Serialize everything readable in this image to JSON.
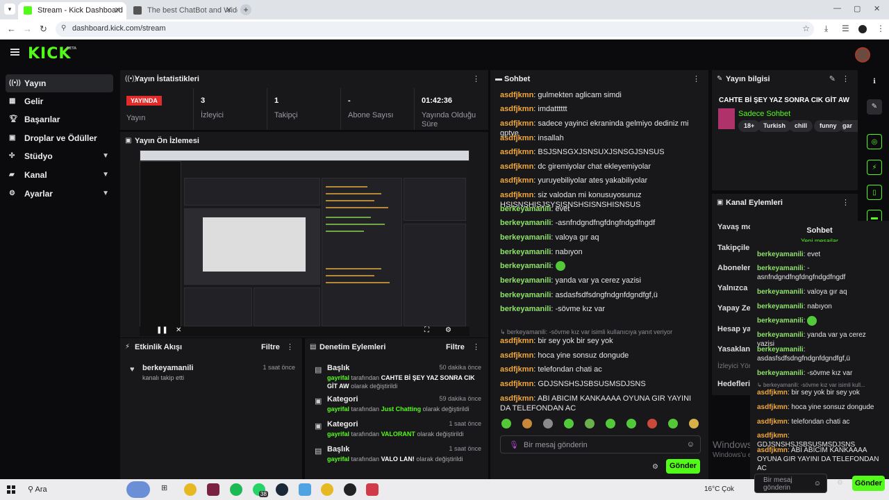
{
  "browser": {
    "tabs": [
      {
        "label": "Stream - Kick Dashboard"
      },
      {
        "label": "The best ChatBot and Widgets"
      }
    ],
    "new_tab": "+",
    "url": "dashboard.kick.com/stream",
    "window_controls": {
      "minimize": "—",
      "restore": "▢",
      "close": "✕"
    }
  },
  "header": {
    "logo": "KICK",
    "beta": "BETA"
  },
  "sidebar": {
    "items": [
      {
        "label": "Yayın",
        "icon": "broadcast-icon"
      },
      {
        "label": "Gelir",
        "icon": "revenue-icon"
      },
      {
        "label": "Başarılar",
        "icon": "trophy-icon"
      },
      {
        "label": "Droplar ve Ödüller",
        "icon": "gift-icon"
      },
      {
        "label": "Stüdyo",
        "icon": "studio-icon"
      },
      {
        "label": "Kanal",
        "icon": "channel-icon"
      },
      {
        "label": "Ayarlar",
        "icon": "settings-icon"
      }
    ]
  },
  "stats": {
    "title": "Yayın İstatistikleri",
    "live_badge": "YAYINDA",
    "live_label": "Yayın",
    "items": [
      {
        "value": "3",
        "label": "İzleyici"
      },
      {
        "value": "1",
        "label": "Takipçi"
      },
      {
        "value": "-",
        "label": "Abone Sayısı"
      },
      {
        "value": "01:42:36",
        "label": "Yayında Olduğu Süre"
      }
    ]
  },
  "preview": {
    "title": "Yayın Ön İzlemesi"
  },
  "activity": {
    "title": "Etkinlik Akışı",
    "filter": "Filtre",
    "items": [
      {
        "user": "berkeyamanili",
        "text": "kanalı takip etti",
        "time": "1 saat önce"
      }
    ]
  },
  "moderation": {
    "title": "Denetim Eylemleri",
    "filter": "Filtre",
    "items": [
      {
        "kind": "Başlık",
        "user": "gayrifal",
        "mid": "tarafından",
        "value": "CAHTE Bİ ŞEY YAZ SONRA CIK GİT AW",
        "tail": "olarak değiştirildi",
        "time": "50 dakika önce"
      },
      {
        "kind": "Kategori",
        "user": "gayrifal",
        "mid": "tarafından",
        "value": "Just Chatting",
        "tail": "olarak değiştirildi",
        "time": "59 dakika önce"
      },
      {
        "kind": "Kategori",
        "user": "gayrifal",
        "mid": "tarafından",
        "value": "VALORANT",
        "tail": "olarak değiştirildi",
        "time": "1 saat önce"
      },
      {
        "kind": "Başlık",
        "user": "gayrifal",
        "mid": "tarafından",
        "value": "VALO LAN!",
        "tail": "olarak değiştirildi",
        "time": "1 saat önce"
      }
    ]
  },
  "chat": {
    "title": "Sohbet",
    "messages": [
      {
        "user": "asdfjkmn",
        "text": "gulmekten aglicam simdi"
      },
      {
        "user": "asdfjkmn",
        "text": "imdatttttt"
      },
      {
        "user": "asdfjkmn",
        "text": "sadece yayinci ekraninda gelmiyo dediniz mi gptye"
      },
      {
        "user": "asdfjkmn",
        "text": "insallah"
      },
      {
        "user": "asdfjkmn",
        "text": "BSJSNSGXJSNSUXJSNSGJSNSUS"
      },
      {
        "user": "asdfjkmn",
        "text": "dc giremiyolar chat ekleyemiyolar"
      },
      {
        "user": "asdfjkmn",
        "text": "yuruyebiliyolar ates yakabiliyolar"
      },
      {
        "user": "asdfjkmn",
        "text": "siz valodan mi konusuyosunuz HSISNSHISJSYSISNSHSISNSHISNSUS"
      },
      {
        "user": "berkeyamanili",
        "text": "evet"
      },
      {
        "user": "berkeyamanili",
        "text": "-asnfndgndfngfdngfndgdfngdf"
      },
      {
        "user": "berkeyamanili",
        "text": "valoya gır aq"
      },
      {
        "user": "berkeyamanili",
        "text": "nabıyon"
      },
      {
        "user": "berkeyamanili",
        "text": ""
      },
      {
        "user": "berkeyamanili",
        "text": "yanda var ya cerez yazisi"
      },
      {
        "user": "berkeyamanili",
        "text": "asdasfsdfsdngfndgnfdgndfgf,ü"
      },
      {
        "user": "berkeyamanili",
        "text": "-sövme kız var"
      },
      {
        "user": "asdfjkmn",
        "text": "bir sey yok bir sey yok"
      },
      {
        "user": "asdfjkmn",
        "text": "hoca yine sonsuz dongude"
      },
      {
        "user": "asdfjkmn",
        "text": "telefondan chati ac"
      },
      {
        "user": "asdfjkmn",
        "text": "GDJSNSHSJSBSUSMSDJSNS"
      },
      {
        "user": "asdfjkmn",
        "text": "ABI ABICIM KANKAAAA OYUNA GIR YAYINI DA TELEFONDAN AC"
      }
    ],
    "reply_hint": "berkeyamanili: -sövme kız var isimli kullanıcıya yanıt veriyor",
    "input_placeholder": "Bir mesaj gönderin",
    "send": "Gönder"
  },
  "stream_info": {
    "title": "Yayın bilgisi",
    "stream_title": "CAHTE Bİ ŞEY YAZ SONRA CIK GİT AW",
    "category": "Sadece Sohbet",
    "tags": [
      "18+",
      "Turkish",
      "chill",
      "funny",
      "gar"
    ]
  },
  "channel_actions": {
    "title": "Kanal Eylemleri",
    "labels": [
      "Yavaş mod",
      "Takipçilere",
      "Abonelere",
      "Yalnızca ifa",
      "Yapay Zek",
      "Hesap yaşı",
      "Yasaklanm",
      "İzleyici Yön",
      "Hedefleri b"
    ]
  },
  "popout": {
    "title": "Sohbet",
    "new_messages": "Yeni mesajlar",
    "messages": [
      {
        "user": "berkeyamanili",
        "text": "evet"
      },
      {
        "user": "berkeyamanili",
        "text": "-asnfndgndfngfdngfndgdfngdf"
      },
      {
        "user": "berkeyamanili",
        "text": "valoya gır aq"
      },
      {
        "user": "berkeyamanili",
        "text": "nabıyon"
      },
      {
        "user": "berkeyamanili",
        "text": ""
      },
      {
        "user": "berkeyamanili",
        "text": "yanda var ya cerez yazisi"
      },
      {
        "user": "berkeyamanili",
        "text": "asdasfsdfsdngfndgnfdgndfgf,ü"
      },
      {
        "user": "berkeyamanili",
        "text": "-sövme kız var"
      },
      {
        "user": "asdfjkmn",
        "text": "bir sey yok bir sey yok"
      },
      {
        "user": "asdfjkmn",
        "text": "hoca yine sonsuz dongude"
      },
      {
        "user": "asdfjkmn",
        "text": "telefondan chati ac"
      },
      {
        "user": "asdfjkmn",
        "text": "GDJSNSHSJSBSUSMSDJSNS"
      },
      {
        "user": "asdfjkmn",
        "text": "ABI ABICIM KANKAAAA OYUNA GIR YAYINI DA TELEFONDAN AC"
      }
    ],
    "reply_hint": "berkeyamanili: -sövme kız var isimli kull...",
    "input_placeholder": "Bir mesaj gönderin",
    "send": "Gönder"
  },
  "watermark": {
    "line1": "Windows",
    "line2": "Windows'u e"
  },
  "taskbar": {
    "search": "Ara",
    "weather": "16°C  Çok",
    "badge": "38"
  },
  "colors": {
    "kick_green": "#53fc18",
    "live_red": "#e22b2b",
    "user_orange": "#f3a93b",
    "user_green": "#8fe36a"
  }
}
